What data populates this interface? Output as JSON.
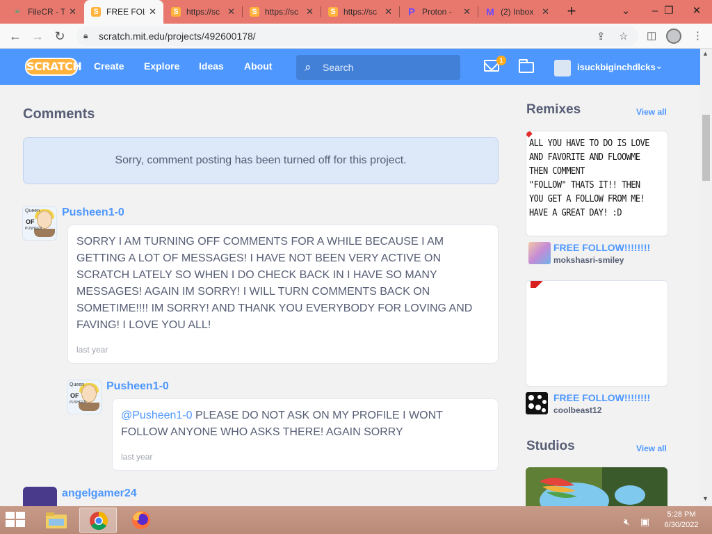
{
  "browser": {
    "tabs": [
      {
        "title": "FileCR - T",
        "favicon": "filecr-icon",
        "active": false
      },
      {
        "title": "FREE FOL",
        "favicon": "scratch-s-icon",
        "active": true
      },
      {
        "title": "https://sc",
        "favicon": "scratch-s-icon",
        "active": false
      },
      {
        "title": "https://sc",
        "favicon": "scratch-s-icon",
        "active": false
      },
      {
        "title": "https://sc",
        "favicon": "scratch-s-icon",
        "active": false
      },
      {
        "title": "Proton -",
        "favicon": "proton-icon",
        "active": false
      },
      {
        "title": "(2) Inbox",
        "favicon": "protonmail-icon",
        "active": false
      }
    ],
    "url": "scratch.mit.edu/projects/492600178/"
  },
  "navbar": {
    "logo": "SCRATCH",
    "links": [
      "Create",
      "Explore",
      "Ideas",
      "About"
    ],
    "search_placeholder": "Search",
    "message_count": "1",
    "username": "isuckbiginchdlcks"
  },
  "comments": {
    "heading": "Comments",
    "notice": "Sorry, comment posting has been turned off for this project.",
    "items": [
      {
        "user": "Pusheen1-0",
        "text": "SORRY I AM TURNING OFF COMMENTS FOR A WHILE BECAUSE I AM GETTING A LOT OF MESSAGES! I HAVE NOT BEEN VERY ACTIVE ON SCRATCH LATELY SO WHEN I DO CHECK BACK IN I HAVE SO MANY MESSAGES! AGAIN IM SORRY! I WILL TURN COMMENTS BACK ON SOMETIME!!!! IM SORRY! AND THANK YOU EVERYBODY FOR LOVING AND FAVING! I LOVE YOU ALL!",
        "time": "last year",
        "avatar_text": [
          "Queen",
          "OF",
          "PUSHEEN"
        ]
      },
      {
        "user": "Pusheen1-0",
        "mention": "@Pusheen1-0",
        "text": " PLEASE DO NOT ASK ON MY PROFILE I WONT FOLLOW ANYONE WHO ASKS THERE! AGAIN SORRY",
        "time": "last year",
        "avatar_text": [
          "Queen",
          "OF",
          "PUSHEEN"
        ]
      },
      {
        "user": "angelgamer24"
      }
    ]
  },
  "sidebar": {
    "remixes": {
      "heading": "Remixes",
      "view_all": "View all",
      "items": [
        {
          "thumb_text": "ALL YOU HAVE TO DO IS LOVE AND FAVORITE AND FLOOWME\n THEN COMMENT \n\"FOLLOW\" THATS IT!! THEN YOU GET A FOLLOW FROM ME! HAVE A GREAT DAY! :D",
          "title": "FREE FOLLOW!!!!!!!!",
          "author": "mokshasri-smiley"
        },
        {
          "thumb_text": "",
          "title": "FREE FOLLOW!!!!!!!!",
          "author": "coolbeast12"
        }
      ]
    },
    "studios": {
      "heading": "Studios",
      "view_all": "View all"
    }
  },
  "taskbar": {
    "time": "5:28 PM",
    "date": "6/30/2022"
  },
  "colors": {
    "scratch_blue": "#4d97ff",
    "tabstrip": "#e8786e",
    "notice_bg": "#dde8f9",
    "text": "#575e75"
  }
}
